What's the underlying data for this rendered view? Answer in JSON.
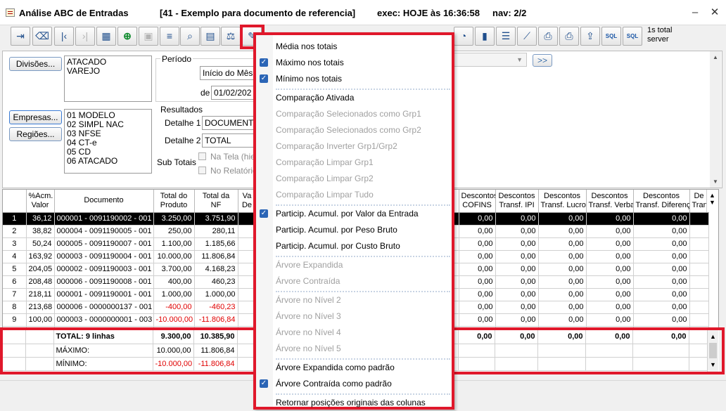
{
  "window": {
    "title": "Análise ABC de Entradas",
    "doc": "[41 - Exemplo para documento de referencia]",
    "exec": "exec: HOJE às 16:36:58",
    "nav": "nav: 2/2",
    "minimize_icon": "minimize-icon",
    "close_icon": "close-icon"
  },
  "toolbar": {
    "sql1": "SQL",
    "sql2": "SQL",
    "count_line1": "1s total",
    "count_line2": "server"
  },
  "filters": {
    "divisoes_btn": "Divisões...",
    "divisoes": [
      "ATACADO",
      "VAREJO"
    ],
    "empresas_btn": "Empresas...",
    "regioes_btn": "Regiões...",
    "empresas": [
      "01 MODELO",
      "02 SIMPL NAC",
      "03 NFSE",
      "04 CT-e",
      "05 CD",
      "06 ATACADO"
    ],
    "periodo_label": "Período",
    "periodo_value": "Início do Mês a",
    "de_label": "de",
    "de_value": "01/02/202",
    "resultados_label": "Resultados",
    "detalhe1_label": "Detalhe 1",
    "detalhe1_value": "DOCUMENTO",
    "detalhe2_label": "Detalhe 2",
    "detalhe2_value": "TOTAL",
    "subtotais_label": "Sub Totais",
    "na_tela": "Na Tela (hie",
    "no_relatorio": "No Relatório",
    "nav_btn": ">>"
  },
  "grid": {
    "headers_left": [
      "%Acm.\nValor",
      "Documento",
      "Total do\nProduto",
      "Total da\nNF",
      "Va\nDe"
    ],
    "headers_right": [
      "Descontos\nCOFINS",
      "Descontos\nTransf. IPI",
      "Descontos\nTransf. Lucro",
      "Descontos\nTransf. Verba",
      "Descontos\nTransf. Diferença",
      "De\nTran"
    ],
    "rows": [
      {
        "n": "1",
        "acm": "36,12",
        "doc": "000001 - 0091190002 - 001",
        "prod": "3.250,00",
        "nf": "3.751,90"
      },
      {
        "n": "2",
        "acm": "38,82",
        "doc": "000004 - 0091190005 - 001",
        "prod": "250,00",
        "nf": "280,11"
      },
      {
        "n": "3",
        "acm": "50,24",
        "doc": "000005 - 0091190007 - 001",
        "prod": "1.100,00",
        "nf": "1.185,66"
      },
      {
        "n": "4",
        "acm": "163,92",
        "doc": "000003 - 0091190004 - 001",
        "prod": "10.000,00",
        "nf": "11.806,84"
      },
      {
        "n": "5",
        "acm": "204,05",
        "doc": "000002 - 0091190003 - 001",
        "prod": "3.700,00",
        "nf": "4.168,23"
      },
      {
        "n": "6",
        "acm": "208,48",
        "doc": "000006 - 0091190008 - 001",
        "prod": "400,00",
        "nf": "460,23"
      },
      {
        "n": "7",
        "acm": "218,11",
        "doc": "000001 - 0091190001 - 001",
        "prod": "1.000,00",
        "nf": "1.000,00"
      },
      {
        "n": "8",
        "acm": "213,68",
        "doc": "000006 - 0000000137 - 001",
        "prod": "-400,00",
        "nf": "-460,23"
      },
      {
        "n": "9",
        "acm": "100,00",
        "doc": "000003 - 0000000001 - 003",
        "prod": "-10.000,00",
        "nf": "-11.806,84"
      }
    ],
    "zero": "0,00",
    "footer": {
      "total_label": "TOTAL: 9 linhas",
      "total_prod": "9.300,00",
      "total_nf": "10.385,90",
      "max_label": "MÁXIMO:",
      "max_prod": "10.000,00",
      "max_nf": "11.806,84",
      "min_label": "MÍNIMO:",
      "min_prod": "-10.000,00",
      "min_nf": "-11.806,84",
      "zero": "0,00"
    }
  },
  "menu": {
    "items": [
      {
        "label": "Média nos totais",
        "checked": false,
        "enabled": true
      },
      {
        "label": "Máximo nos totais",
        "checked": true,
        "enabled": true
      },
      {
        "label": "Mínimo nos totais",
        "checked": true,
        "enabled": true
      },
      {
        "label": "Comparação Ativada",
        "checked": false,
        "enabled": true
      },
      {
        "label": "Comparação Selecionados como Grp1",
        "checked": false,
        "enabled": false
      },
      {
        "label": "Comparação Selecionados como Grp2",
        "checked": false,
        "enabled": false
      },
      {
        "label": "Comparação Inverter Grp1/Grp2",
        "checked": false,
        "enabled": false
      },
      {
        "label": "Comparação Limpar Grp1",
        "checked": false,
        "enabled": false
      },
      {
        "label": "Comparação Limpar Grp2",
        "checked": false,
        "enabled": false
      },
      {
        "label": "Comparação Limpar Tudo",
        "checked": false,
        "enabled": false
      },
      {
        "label": "Particip. Acumul. por Valor da Entrada",
        "checked": true,
        "enabled": true
      },
      {
        "label": "Particip. Acumul. por Peso Bruto",
        "checked": false,
        "enabled": true
      },
      {
        "label": "Particip. Acumul. por Custo Bruto",
        "checked": false,
        "enabled": true
      },
      {
        "label": "Árvore Expandida",
        "checked": false,
        "enabled": false
      },
      {
        "label": "Árvore Contraída",
        "checked": false,
        "enabled": false
      },
      {
        "label": "Árvore no Nível 2",
        "checked": false,
        "enabled": false
      },
      {
        "label": "Árvore no Nível 3",
        "checked": false,
        "enabled": false
      },
      {
        "label": "Árvore no Nível 4",
        "checked": false,
        "enabled": false
      },
      {
        "label": "Árvore no Nível 5",
        "checked": false,
        "enabled": false
      },
      {
        "label": "Árvore Expandida como padrão",
        "checked": false,
        "enabled": true
      },
      {
        "label": "Árvore Contraída como padrão",
        "checked": true,
        "enabled": true
      },
      {
        "label": "Retornar posições originais das colunas",
        "checked": false,
        "enabled": true
      }
    ]
  }
}
